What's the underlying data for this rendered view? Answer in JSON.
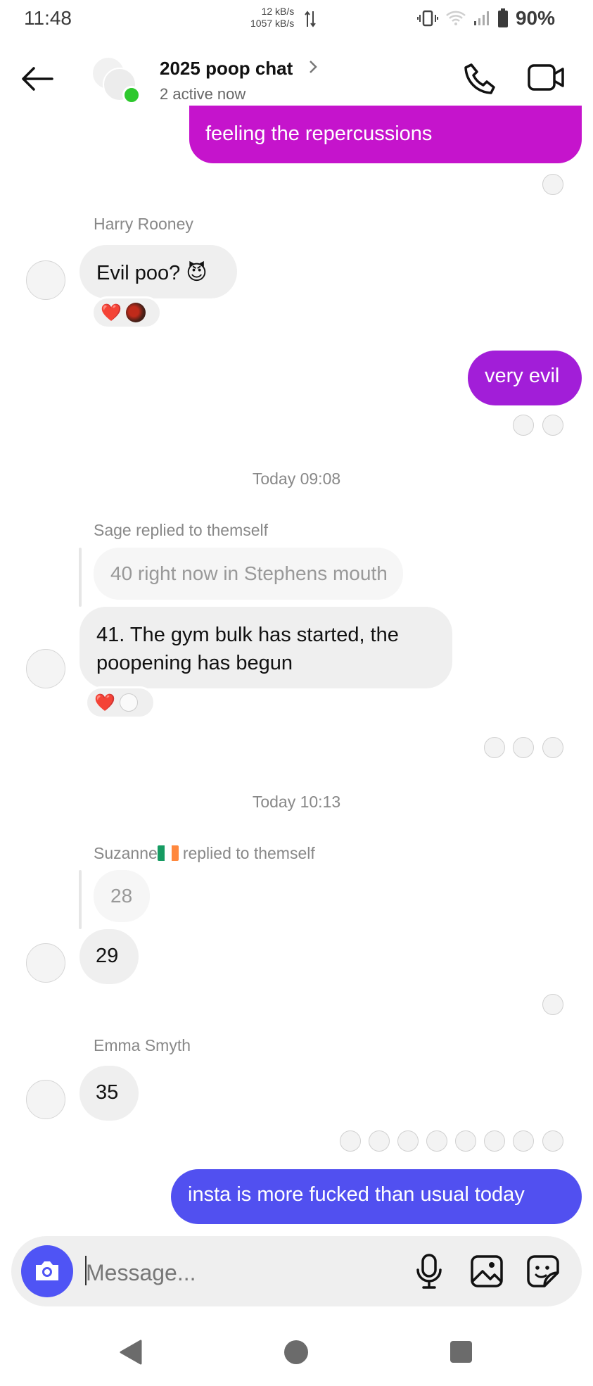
{
  "status_bar": {
    "time": "11:48",
    "net_up": "12 kB/s",
    "net_down": "1057 kB/s",
    "battery": "90%"
  },
  "header": {
    "title": "2025 poop chat",
    "subtitle": "2 active now",
    "icons": [
      "back-arrow-icon",
      "chevron-right-icon",
      "phone-icon",
      "video-camera-icon"
    ]
  },
  "messages": {
    "m1": {
      "text": "feeling the repercussions"
    },
    "harry": {
      "sender": "Harry Rooney",
      "text": "Evil poo? 😈",
      "reactions": [
        "❤️"
      ]
    },
    "m2": {
      "text": "very evil"
    },
    "ts1": "Today 09:08",
    "sage": {
      "sender": "Sage replied to themself",
      "quoted": "40 right now in Stephens mouth",
      "text_line1": "41. The gym bulk has started, the",
      "text_line2": "poopening has begun",
      "reactions": [
        "❤️"
      ]
    },
    "ts2": "Today 10:13",
    "suzanne": {
      "sender_name": "Suzanne",
      "sender_suffix": "replied to themself",
      "quoted": "28",
      "text": "29"
    },
    "emma": {
      "sender": "Emma Smyth",
      "text": "35"
    },
    "m3": {
      "text": "insta is more fucked than usual today"
    }
  },
  "composer": {
    "placeholder": "Message..."
  },
  "colors": {
    "magenta_bubble": "#c514cc",
    "purple_bubble": "#a21ed8",
    "blue_bubble": "#5150f0",
    "camera_button": "#4f54f5",
    "inbound_bubble": "#efefef"
  }
}
